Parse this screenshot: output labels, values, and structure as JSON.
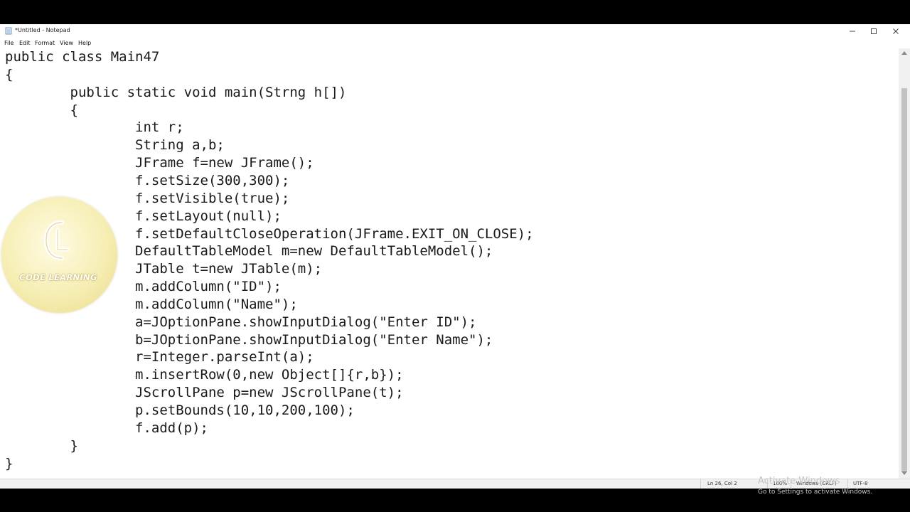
{
  "window": {
    "title": "*Untitled - Notepad",
    "controls": [
      "minimize",
      "maximize",
      "close"
    ]
  },
  "menu": [
    "File",
    "Edit",
    "Format",
    "View",
    "Help"
  ],
  "editor": {
    "lines": [
      "public class Main47",
      "{",
      "        public static void main(Strng h[])",
      "        {",
      "                int r;",
      "                String a,b;",
      "                JFrame f=new JFrame();",
      "                f.setSize(300,300);",
      "                f.setVisible(true);",
      "                f.setLayout(null);",
      "                f.setDefaultCloseOperation(JFrame.EXIT_ON_CLOSE);",
      "                DefaultTableModel m=new DefaultTableModel();",
      "                JTable t=new JTable(m);",
      "                m.addColumn(\"ID\");",
      "                m.addColumn(\"Name\");",
      "                a=JOptionPane.showInputDialog(\"Enter ID\");",
      "                b=JOptionPane.showInputDialog(\"Enter Name\");",
      "                r=Integer.parseInt(a);",
      "                m.insertRow(0,new Object[]{r,b});",
      "                JScrollPane p=new JScrollPane(t);",
      "                p.setBounds(10,10,200,100);",
      "                f.add(p);",
      "        }",
      "}"
    ]
  },
  "status": {
    "position": "Ln 26, Col 2",
    "zoom": "100%",
    "line_ending": "Windows (CRLF)",
    "encoding": "UTF-8"
  },
  "activation": {
    "title": "Activate Windows",
    "subtitle": "Go to Settings to activate Windows."
  },
  "logo": {
    "text": "CODE LEARNING",
    "colors": {
      "fill": "#f4ebb0",
      "mark": "#ffffff"
    }
  }
}
